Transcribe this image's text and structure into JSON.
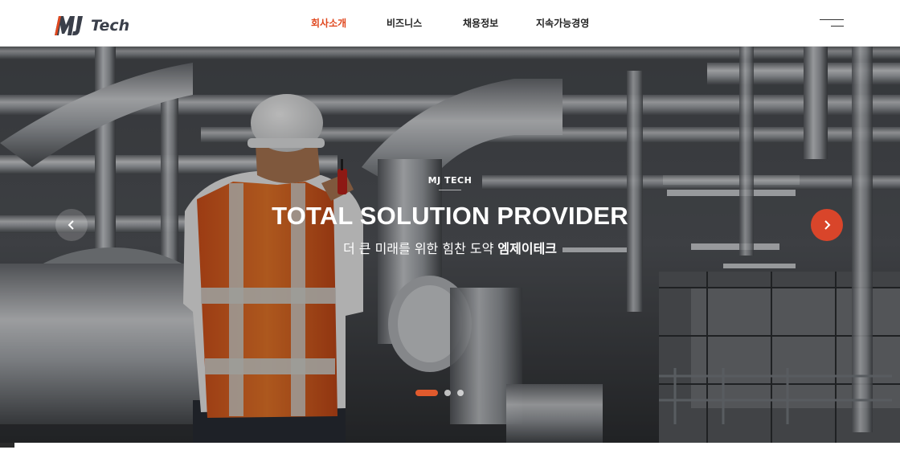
{
  "logo": {
    "mark": "MJ",
    "word": "Tech"
  },
  "nav": {
    "items": [
      {
        "label": "회사소개",
        "active": true
      },
      {
        "label": "비즈니스",
        "active": false
      },
      {
        "label": "채용정보",
        "active": false
      },
      {
        "label": "지속가능경영",
        "active": false
      }
    ],
    "menu_icon": "hamburger-icon"
  },
  "hero": {
    "subtitle": "MJ TECH",
    "title": "TOTAL SOLUTION PROVIDER",
    "tagline_prefix": "더 큰 미래를 위한 힘찬 도약 ",
    "tagline_emphasis": "엠제이테크",
    "prev_icon": "chevron-left-icon",
    "next_icon": "chevron-right-icon",
    "slides_total": 3,
    "active_slide": 1
  },
  "colors": {
    "accent": "#e0481f",
    "next_button": "#d9452a",
    "text_dark": "#222222"
  }
}
